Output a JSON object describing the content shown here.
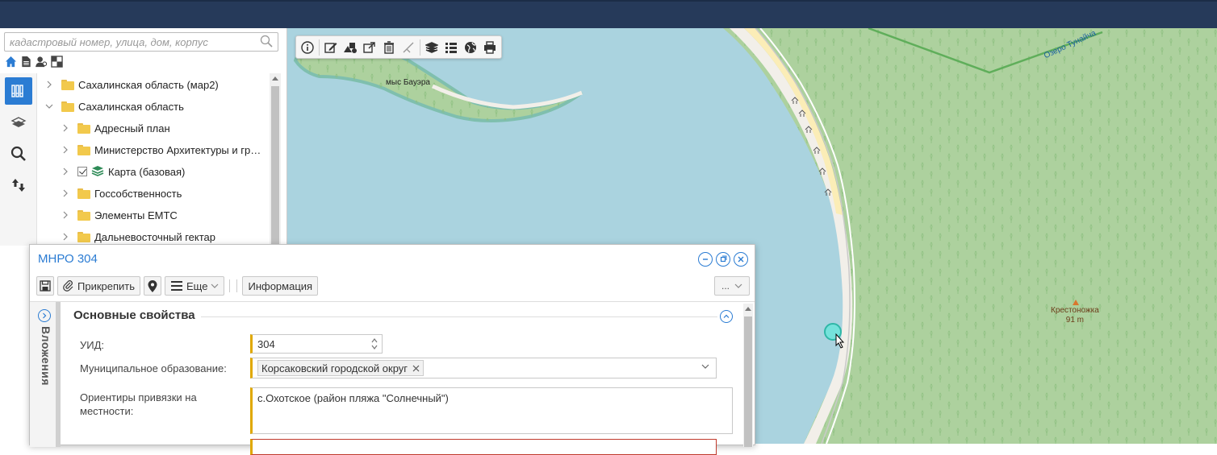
{
  "search": {
    "placeholder": "кадастровый номер, улица, дом, корпус"
  },
  "tree": {
    "items": [
      {
        "label": "Сахалинская область (мар2)",
        "level": 0,
        "expanded": false,
        "kind": "folder"
      },
      {
        "label": "Сахалинская область",
        "level": 0,
        "expanded": true,
        "kind": "folder"
      },
      {
        "label": "Адресный план",
        "level": 1,
        "expanded": false,
        "kind": "folder"
      },
      {
        "label": "Министерство Архитектуры и гр…",
        "level": 1,
        "expanded": false,
        "kind": "folder"
      },
      {
        "label": "Карта (базовая)",
        "level": 1,
        "expanded": false,
        "kind": "layer",
        "checked": true
      },
      {
        "label": "Госсобственность",
        "level": 1,
        "expanded": false,
        "kind": "folder"
      },
      {
        "label": "Элементы ЕМТС",
        "level": 1,
        "expanded": false,
        "kind": "folder"
      },
      {
        "label": "Дальневосточный гектар",
        "level": 1,
        "expanded": false,
        "kind": "folder"
      }
    ]
  },
  "map": {
    "labels": {
      "cape": "мыс Бауэра",
      "lake": "Озеро Тунайча",
      "peak_name": "Крестоножка",
      "peak_elev": "91 m"
    }
  },
  "dialog": {
    "title": "МНРО 304",
    "toolbar": {
      "attach_label": "Прикрепить",
      "more_label": "Еще",
      "info_label": "Информация",
      "overflow_label": "..."
    },
    "attachments_label": "Вложения",
    "section_title": "Основные свойства",
    "fields": {
      "uid_label": "УИД:",
      "uid_value": "304",
      "municipality_label": "Муниципальное образование:",
      "municipality_value": "Корсаковский городской округ",
      "landmarks_label": "Ориентиры привязки на местности:",
      "landmarks_value": "с.Охотское (район пляжа \"Солнечный\")"
    }
  },
  "colors": {
    "topbar": "#263a5a",
    "accent": "#2b7cd3",
    "water": "#aad3df",
    "forest": "#add19e",
    "beach": "#fbedb7",
    "required": "#e0a800"
  }
}
